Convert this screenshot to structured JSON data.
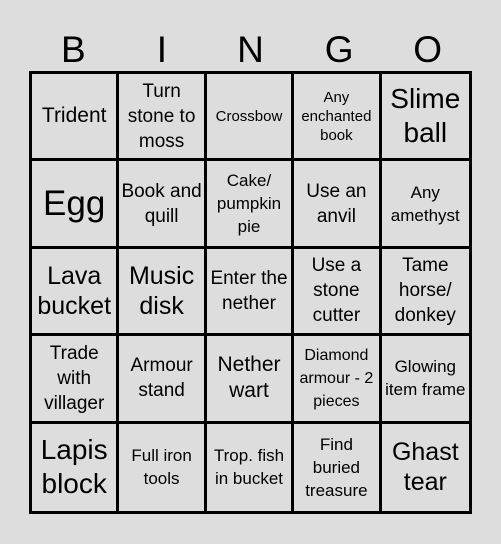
{
  "header": {
    "letters": [
      "B",
      "I",
      "N",
      "G",
      "O"
    ]
  },
  "board": {
    "cells": [
      "Trident",
      "Turn stone to moss",
      "Crossbow",
      "Any enchanted book",
      "Slime ball",
      "Egg",
      "Book and quill",
      "Cake/ pumpkin pie",
      "Use an anvil",
      "Any amethyst",
      "Lava bucket",
      "Music disk",
      "Enter the nether",
      "Use a stone cutter",
      "Tame horse/ donkey",
      "Trade with villager",
      "Armour stand",
      "Nether wart",
      "Diamond armour - 2 pieces",
      "Glowing item frame",
      "Lapis block",
      "Full iron tools",
      "Trop. fish in bucket",
      "Find buried treasure",
      "Ghast tear"
    ]
  },
  "colors": {
    "background": "#dddddd",
    "grid_line": "#000000",
    "text": "#000000"
  }
}
